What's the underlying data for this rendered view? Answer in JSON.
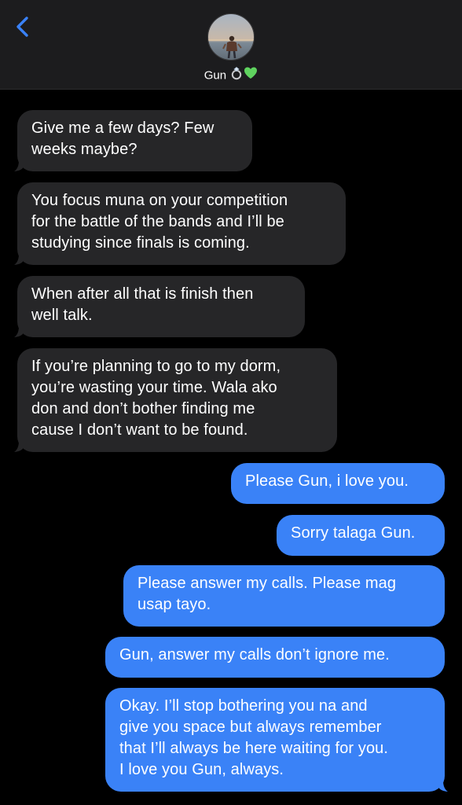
{
  "colors": {
    "background": "#000000",
    "header_bg": "#1c1c1e",
    "incoming_bubble": "#262628",
    "outgoing_bubble": "#3a82f7",
    "accent": "#3a82f7"
  },
  "header": {
    "back_icon": "chevron-left-icon",
    "contact_name": "Gun",
    "name_emoji_1": "💍",
    "name_emoji_2": "💚"
  },
  "messages": [
    {
      "direction": "in",
      "text": "Give me a few days? Few\nweeks maybe?"
    },
    {
      "direction": "in",
      "text": "You focus muna on your competition\nfor the battle of the bands and I’ll be\nstudying since finals is coming."
    },
    {
      "direction": "in",
      "text": "When after all that is finish then\nwell talk."
    },
    {
      "direction": "in",
      "text": "If you’re planning to go to my dorm,\nyou’re wasting your time. Wala ako\ndon and don’t bother finding me\ncause I don’t want to be found."
    },
    {
      "direction": "out",
      "text": "Please Gun, i love you."
    },
    {
      "direction": "out",
      "text": "Sorry talaga Gun."
    },
    {
      "direction": "out",
      "text": "Please answer my calls. Please mag\nusap tayo."
    },
    {
      "direction": "out",
      "text": "Gun, answer my calls don’t ignore me."
    },
    {
      "direction": "out",
      "text": "Okay. I’ll stop bothering you na and\ngive you space but always remember\nthat I’ll always be here waiting for you.\nI love you Gun, always."
    }
  ]
}
